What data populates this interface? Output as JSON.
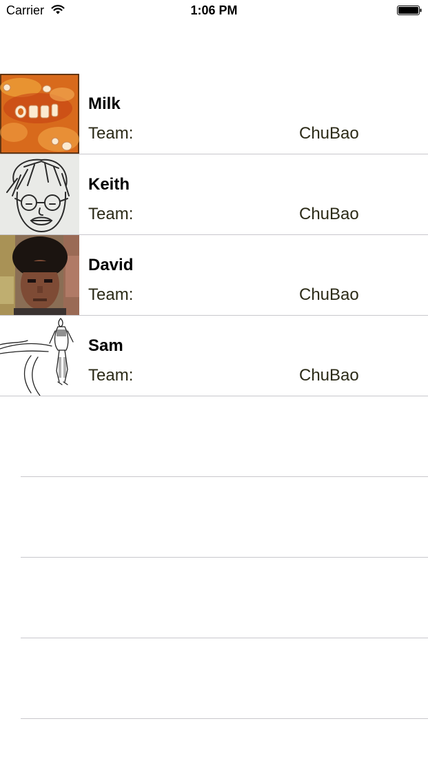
{
  "status_bar": {
    "carrier": "Carrier",
    "time": "1:06 PM",
    "wifi_icon": "wifi-icon",
    "battery_icon": "battery-icon"
  },
  "members": [
    {
      "name": "Milk",
      "team_label": "Team:",
      "team_value": "ChuBao",
      "avatar": "alphabet-soup-photo"
    },
    {
      "name": "Keith",
      "team_label": "Team:",
      "team_value": "ChuBao",
      "avatar": "face-sketch-drawing"
    },
    {
      "name": "David",
      "team_label": "Team:",
      "team_value": "ChuBao",
      "avatar": "person-photo"
    },
    {
      "name": "Sam",
      "team_label": "Team:",
      "team_value": "ChuBao",
      "avatar": "hiker-ink-drawing"
    }
  ],
  "colors": {
    "separator": "#c8c7cc",
    "team_text": "#2b2a17",
    "name_text": "#000000"
  }
}
